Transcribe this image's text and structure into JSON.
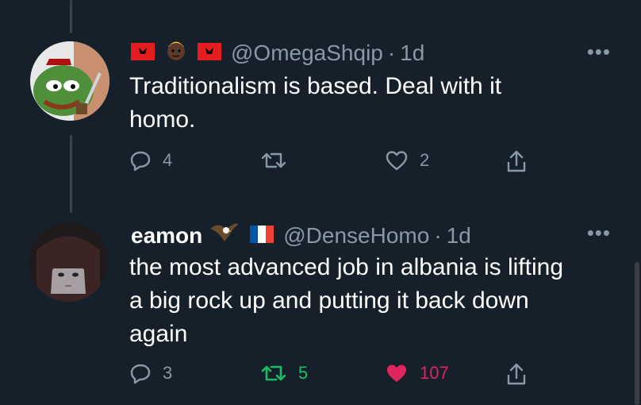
{
  "tweets": [
    {
      "name": "",
      "handle": "@OmegaShqip",
      "dot": "·",
      "time": "1d",
      "text": "Traditionalism is based. Deal with it\nhomo.",
      "replies": "4",
      "retweets": "",
      "likes": "2",
      "retweeted": false,
      "liked": false,
      "name_emojis": [
        "flag-albania",
        "face-dark-skin",
        "flag-albania"
      ],
      "avatar_icon": "pepe-avatar"
    },
    {
      "name": "eamon",
      "handle": "@DenseHomo",
      "dot": "·",
      "time": "1d",
      "text": "the most advanced job in albania is lifting\na big rock up and putting it back down\nagain",
      "replies": "3",
      "retweets": "5",
      "likes": "107",
      "retweeted": true,
      "liked": true,
      "name_emojis": [
        "eagle",
        "flag-france"
      ],
      "avatar_icon": "anime-girl-avatar"
    }
  ],
  "more_label": "•••",
  "colors": {
    "background": "#15202b",
    "text": "#ffffff",
    "muted": "#8899a6",
    "retweet_active": "#17bf63",
    "like_active": "#e0245e",
    "thread_line": "#38444d"
  }
}
